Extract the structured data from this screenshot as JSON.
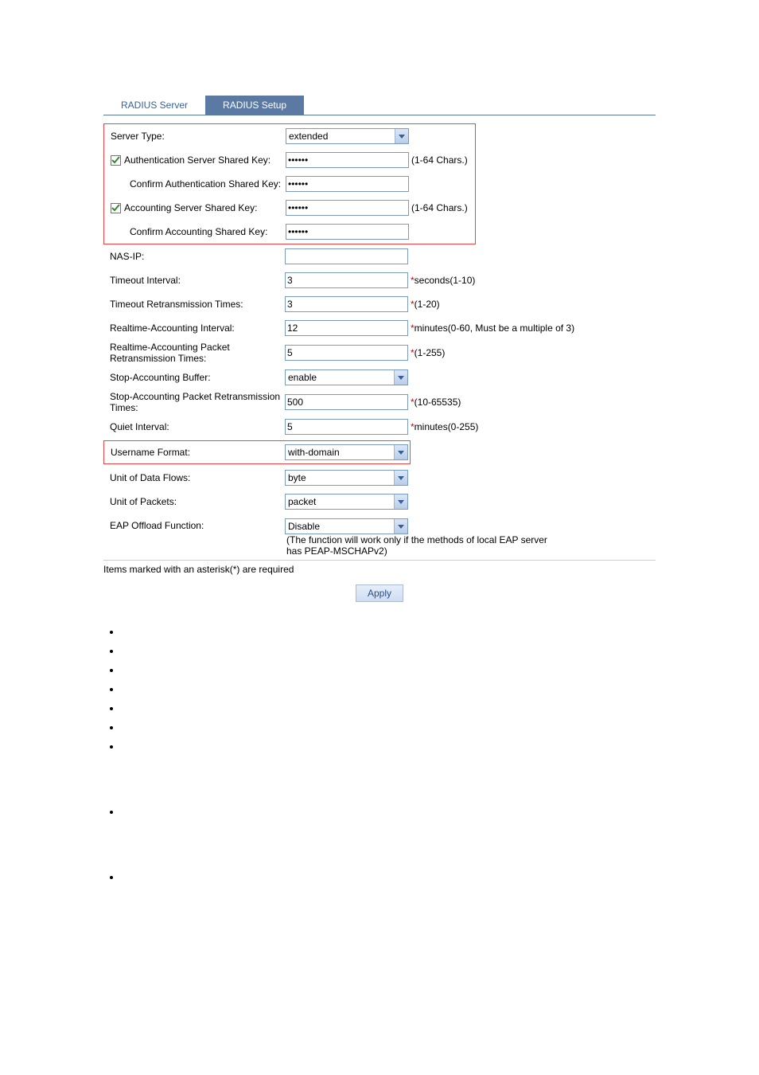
{
  "tabs": {
    "radius_server": "RADIUS Server",
    "radius_setup": "RADIUS Setup"
  },
  "rows": {
    "server_type": {
      "label": "Server Type:",
      "value": "extended"
    },
    "auth_key": {
      "label": "Authentication Server Shared Key:",
      "value": "••••••",
      "hint": "(1-64 Chars.)"
    },
    "auth_key_c": {
      "label": "Confirm Authentication Shared Key:",
      "value": "••••••"
    },
    "acct_key": {
      "label": "Accounting Server Shared Key:",
      "value": "••••••",
      "hint": "(1-64 Chars.)"
    },
    "acct_key_c": {
      "label": "Confirm Accounting Shared Key:",
      "value": "••••••"
    },
    "nas_ip": {
      "label": "NAS-IP:",
      "value": ""
    },
    "timeout": {
      "label": "Timeout Interval:",
      "value": "3",
      "hint": "seconds(1-10)"
    },
    "timeout_rt": {
      "label": "Timeout Retransmission Times:",
      "value": "3",
      "hint": "(1-20)"
    },
    "rt_acct_int": {
      "label": "Realtime-Accounting Interval:",
      "value": "12",
      "hint": "minutes(0-60, Must be a multiple of 3)"
    },
    "rt_acct_pkt": {
      "label": "Realtime-Accounting Packet Retransmission Times:",
      "value": "5",
      "hint": "(1-255)"
    },
    "stop_buf": {
      "label": "Stop-Accounting Buffer:",
      "value": "enable"
    },
    "stop_pkt": {
      "label": "Stop-Accounting Packet Retransmission Times:",
      "value": "500",
      "hint": "(10-65535)"
    },
    "quiet": {
      "label": "Quiet Interval:",
      "value": "5",
      "hint": "minutes(0-255)"
    },
    "uname_fmt": {
      "label": "Username Format:",
      "value": "with-domain"
    },
    "unit_data": {
      "label": "Unit of Data Flows:",
      "value": "byte"
    },
    "unit_pkt": {
      "label": "Unit of Packets:",
      "value": "packet"
    },
    "eap": {
      "label": "EAP Offload Function:",
      "value": "Disable",
      "hint": "(The function will work only if the methods of local EAP server has PEAP-MSCHAPv2)"
    }
  },
  "footnote": "Items marked with an asterisk(*) are required",
  "apply_label": "Apply",
  "star": "*"
}
